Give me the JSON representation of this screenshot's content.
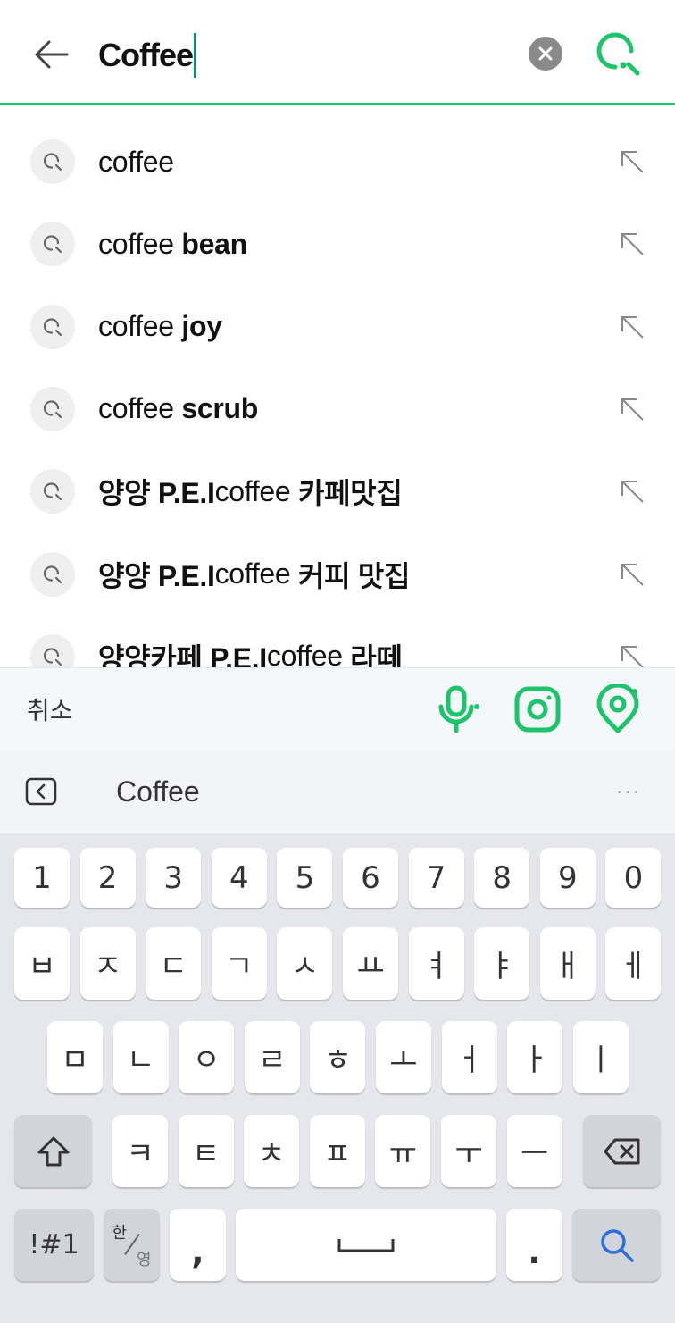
{
  "search": {
    "query": "Coffee"
  },
  "suggestions": [
    {
      "prefix": "",
      "normal": "coffee",
      "suffix": ""
    },
    {
      "prefix": "",
      "normal": "coffee ",
      "suffix": "bean"
    },
    {
      "prefix": "",
      "normal": "coffee ",
      "suffix": "joy"
    },
    {
      "prefix": "",
      "normal": "coffee ",
      "suffix": "scrub"
    },
    {
      "prefix": "양양 P.E.I ",
      "normal": "coffee ",
      "suffix": "카페맛집"
    },
    {
      "prefix": "양양 P.E.I ",
      "normal": "coffee ",
      "suffix": "커피 맛집"
    },
    {
      "prefix": "양양카페 P.E.I ",
      "normal": "coffee ",
      "suffix": "라떼"
    }
  ],
  "action_bar": {
    "cancel_label": "취소",
    "icons": [
      "microphone-icon",
      "camera-lens-icon",
      "location-pin-icon"
    ],
    "accent_color": "#1ec46b"
  },
  "keyboard": {
    "suggestion_word": "Coffee",
    "more_label": "···",
    "number_row": [
      "1",
      "2",
      "3",
      "4",
      "5",
      "6",
      "7",
      "8",
      "9",
      "0"
    ],
    "row1": [
      "ㅂ",
      "ㅈ",
      "ㄷ",
      "ㄱ",
      "ㅅ",
      "ㅛ",
      "ㅕ",
      "ㅑ",
      "ㅐ",
      "ㅔ"
    ],
    "row2": [
      "ㅁ",
      "ㄴ",
      "ㅇ",
      "ㄹ",
      "ㅎ",
      "ㅗ",
      "ㅓ",
      "ㅏ",
      "ㅣ"
    ],
    "row3": [
      "ㅋ",
      "ㅌ",
      "ㅊ",
      "ㅍ",
      "ㅠ",
      "ㅜ",
      "ㅡ"
    ],
    "symbols_label": "!#1",
    "lang_top": "한",
    "lang_bottom": "영",
    "comma_label": ",",
    "period_label": ".",
    "search_key_color": "#2b6fdc"
  }
}
